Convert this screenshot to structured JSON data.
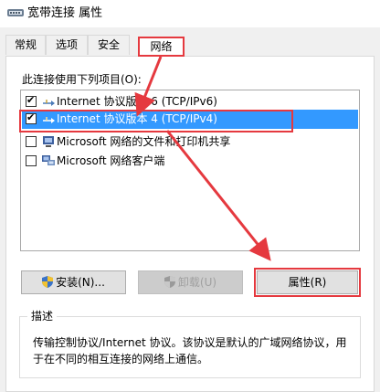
{
  "window": {
    "title": "宽带连接 属性",
    "icon": "network-connection-icon"
  },
  "tabs": [
    "常规",
    "选项",
    "安全",
    "网络"
  ],
  "active_tab": "网络",
  "items_label": "此连接使用下列项目(O):",
  "items": [
    {
      "label": "Internet 协议版本 6 (TCP/IPv6)",
      "checked": true,
      "icon": "protocol-icon"
    },
    {
      "label": "Internet 协议版本 4 (TCP/IPv4)",
      "checked": true,
      "icon": "protocol-icon",
      "selected": true
    },
    {
      "label": "Microsoft 网络的文件和打印机共享",
      "checked": false,
      "icon": "network-service-icon"
    },
    {
      "label": "Microsoft 网络客户端",
      "checked": false,
      "icon": "network-client-icon"
    }
  ],
  "buttons": {
    "install": "安装(N)...",
    "uninstall": "卸载(U)",
    "properties": "属性(R)"
  },
  "description": {
    "title": "描述",
    "text": "传输控制协议/Internet 协议。该协议是默认的广域网络协议，用于在不同的相互连接的网络上通信。"
  },
  "colors": {
    "highlight": "#3399ff",
    "annotation": "#e5393f"
  }
}
